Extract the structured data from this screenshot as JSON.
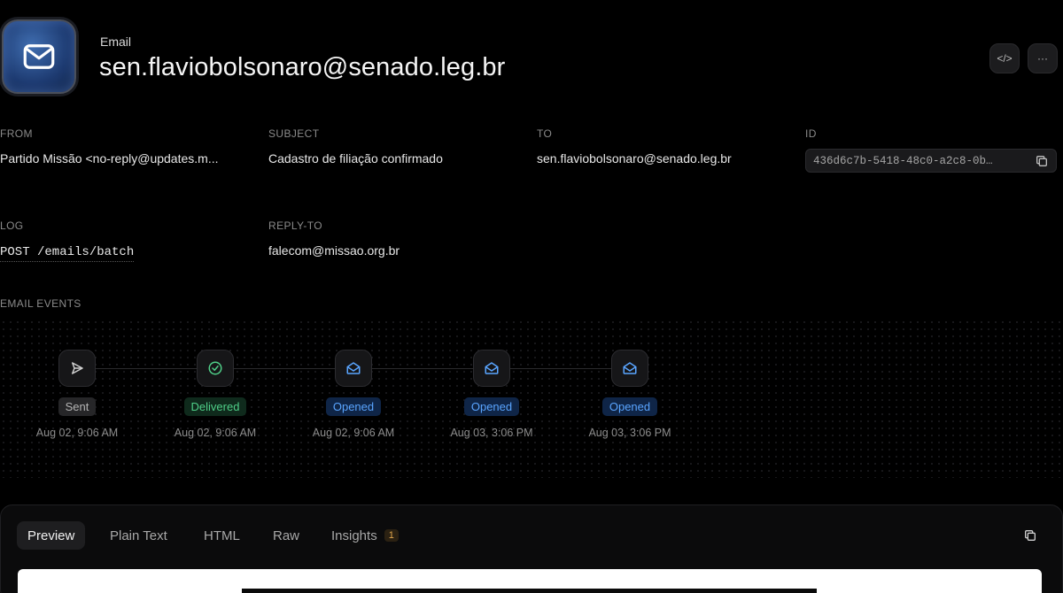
{
  "header": {
    "kicker": "Email",
    "title": "sen.flaviobolsonaro@senado.leg.br",
    "icon": "envelope-icon",
    "actions": [
      {
        "name": "code-icon",
        "label": "</>"
      },
      {
        "name": "more-icon",
        "label": "···"
      }
    ]
  },
  "fields": {
    "from_label": "FROM",
    "from_value": "Partido Missão <no-reply@updates.m...",
    "subject_label": "SUBJECT",
    "subject_value": "Cadastro de filiação confirmado",
    "to_label": "TO",
    "to_value": "sen.flaviobolsonaro@senado.leg.br",
    "id_label": "ID",
    "id_value": "436d6c7b-5418-48c0-a2c8-0b…",
    "log_label": "LOG",
    "log_value": "POST /emails/batch",
    "replyto_label": "REPLY-TO",
    "replyto_value": "falecom@missao.org.br"
  },
  "events": {
    "label": "EMAIL EVENTS",
    "items": [
      {
        "status": "Sent",
        "time": "Aug 02, 9:06 AM",
        "icon": "send-icon",
        "kind": "sent"
      },
      {
        "status": "Delivered",
        "time": "Aug 02, 9:06 AM",
        "icon": "check-circle-icon",
        "kind": "delivered"
      },
      {
        "status": "Opened",
        "time": "Aug 02, 9:06 AM",
        "icon": "mail-open-icon",
        "kind": "opened"
      },
      {
        "status": "Opened",
        "time": "Aug 03, 3:06 PM",
        "icon": "mail-open-icon",
        "kind": "opened"
      },
      {
        "status": "Opened",
        "time": "Aug 03, 3:06 PM",
        "icon": "mail-open-icon",
        "kind": "opened"
      }
    ]
  },
  "preview": {
    "tabs": [
      {
        "label": "Preview",
        "active": true
      },
      {
        "label": "Plain Text",
        "active": false
      },
      {
        "label": "HTML",
        "active": false
      },
      {
        "label": "Raw",
        "active": false
      },
      {
        "label": "Insights",
        "active": false,
        "count": "1"
      }
    ]
  },
  "colors": {
    "delivered": "#4fcf88",
    "opened": "#5aa5ff",
    "insights_count": "#e2a64d"
  }
}
